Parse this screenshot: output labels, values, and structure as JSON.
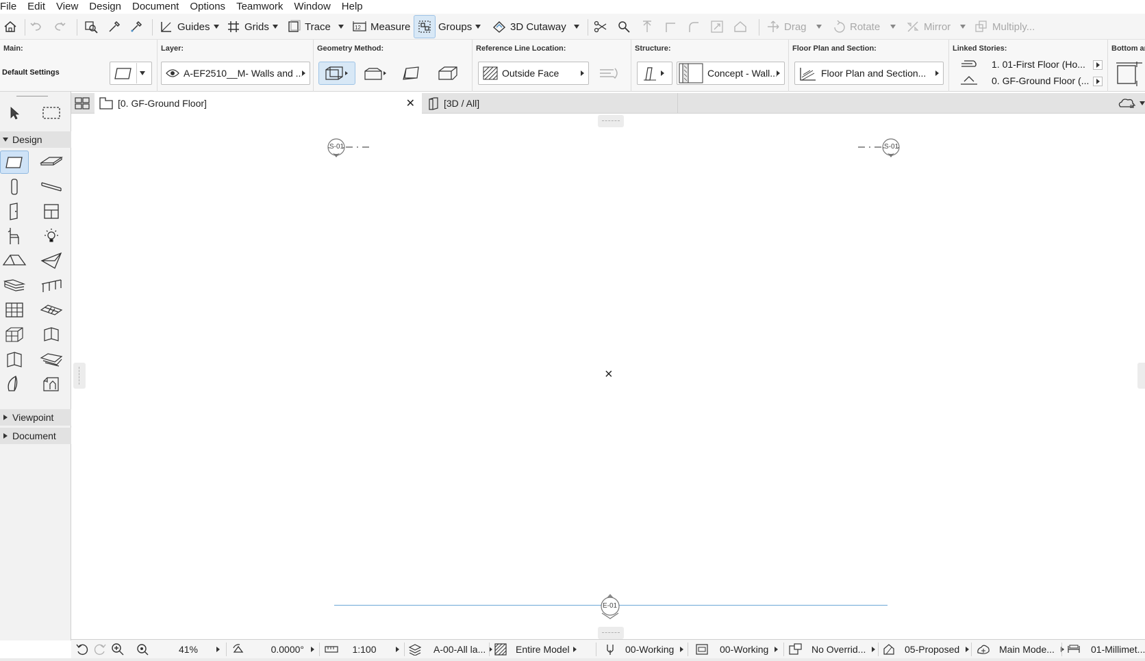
{
  "menu": [
    "File",
    "Edit",
    "View",
    "Design",
    "Document",
    "Options",
    "Teamwork",
    "Window",
    "Help"
  ],
  "toolbar": {
    "guides": "Guides",
    "grids": "Grids",
    "trace": "Trace",
    "measure": "Measure",
    "groups": "Groups",
    "cutaway": "3D Cutaway",
    "drag": "Drag",
    "rotate": "Rotate",
    "mirror": "Mirror",
    "multiply": "Multiply..."
  },
  "infobox": {
    "main_title": "Main:",
    "main_value": "Default Settings",
    "layer_title": "Layer:",
    "layer_value": "A-EF2510__M- Walls and ...",
    "geometry_title": "Geometry Method:",
    "refline_title": "Reference Line Location:",
    "refline_value": "Outside Face",
    "structure_title": "Structure:",
    "structure_value": "Concept - Wall...",
    "fps_title": "Floor Plan and Section:",
    "fps_value": "Floor Plan and Section...",
    "linked_title": "Linked Stories:",
    "linked_top": "1. 01-First Floor (Ho...",
    "linked_bottom": "0. GF-Ground Floor (...",
    "bottom_title": "Bottom ar"
  },
  "toolbox": {
    "design": "Design",
    "viewpoint": "Viewpoint",
    "document": "Document"
  },
  "tabs": {
    "floor": "[0. GF-Ground Floor]",
    "threed": "[3D / All]"
  },
  "canvas": {
    "marker_left": "S-01",
    "marker_right": "S-01",
    "marker_bottom": "E-01",
    "center_mark": "×"
  },
  "status": {
    "zoom": "41%",
    "angle": "0.0000°",
    "scale": "1:100",
    "layers": "A-00-All la...",
    "model": "Entire Model",
    "pen": "00-Working",
    "view": "00-Working",
    "override": "No Overrid...",
    "renovation": "05-Proposed",
    "mvo": "Main Mode...",
    "dimension": "01-Millimet..."
  },
  "colors": {
    "accent": "#4a90c8",
    "canvas": "#ffffff",
    "panel": "#f2f2f2"
  }
}
